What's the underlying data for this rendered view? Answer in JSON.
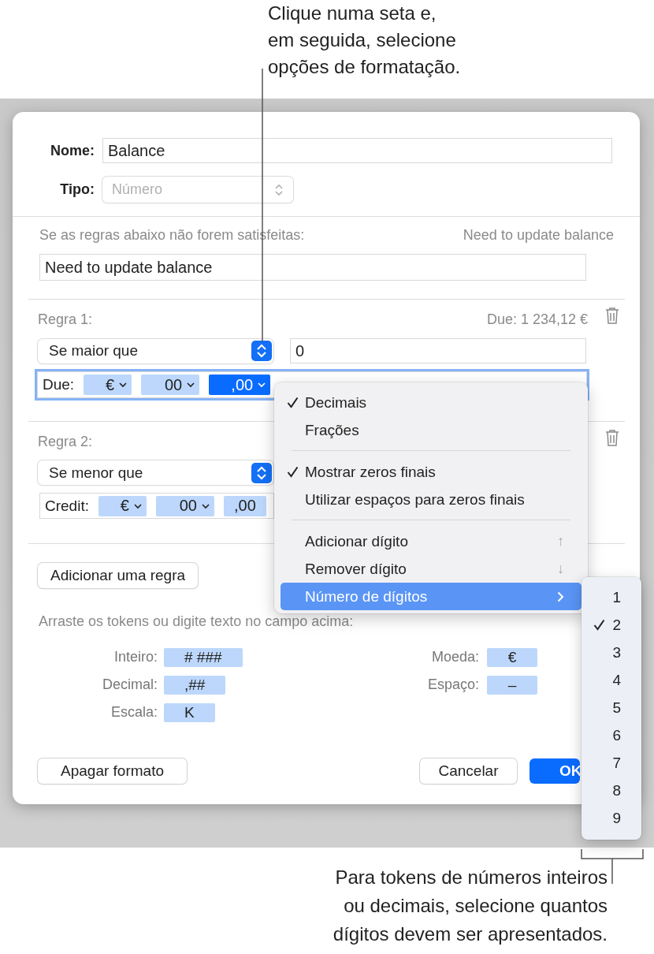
{
  "top_callout": "Clique numa seta e,\nem seguida, selecione\nopções de formatação.",
  "dialog": {
    "name_label": "Nome:",
    "name_value": "Balance",
    "type_label": "Tipo:",
    "type_value": "Número",
    "type_disabled": true,
    "fallback_label": "Se as regras abaixo não forem satisfeitas:",
    "fallback_preview": "Need to update balance",
    "fallback_value": "Need to update balance",
    "rules": [
      {
        "label": "Regra 1:",
        "preview": "Due: 1 234,12 €",
        "condition": "Se maior que",
        "value": "0",
        "format_focused": true,
        "format_label": "Due:",
        "tokens": [
          {
            "text": "€",
            "selected": false,
            "caret": true
          },
          {
            "text": "00",
            "selected": false,
            "caret": true
          },
          {
            "text": ",00",
            "selected": true,
            "caret": true
          }
        ]
      },
      {
        "label": "Regra 2:",
        "condition": "Se menor que",
        "format_focused": false,
        "format_label": "Credit:",
        "tokens": [
          {
            "text": "€",
            "selected": false,
            "caret": true
          },
          {
            "text": "00",
            "selected": false,
            "caret": true
          },
          {
            "text": ",00",
            "selected": false,
            "caret": false
          }
        ]
      }
    ],
    "add_rule_button": "Adicionar uma regra",
    "hint": "Arraste os tokens ou digite texto no campo acima:",
    "palette_left": [
      {
        "label": "Inteiro:",
        "token": "# ###"
      },
      {
        "label": "Decimal:",
        "token": ",##"
      },
      {
        "label": "Escala:",
        "token": "K"
      }
    ],
    "palette_right": [
      {
        "label": "Moeda:",
        "token": "€"
      },
      {
        "label": "Espaço:",
        "token": "–"
      }
    ],
    "buttons": [
      {
        "label": "Apagar formato",
        "kind": "plain"
      },
      {
        "label": "Cancelar",
        "kind": "plain"
      },
      {
        "label": "OK",
        "kind": "default"
      }
    ]
  },
  "menu": {
    "items": [
      {
        "kind": "item",
        "label": "Decimais",
        "checked": true
      },
      {
        "kind": "item",
        "label": "Frações",
        "checked": false
      },
      {
        "kind": "separator"
      },
      {
        "kind": "item",
        "label": "Mostrar zeros finais",
        "checked": true
      },
      {
        "kind": "item",
        "label": "Utilizar espaços para zeros finais",
        "checked": false
      },
      {
        "kind": "separator"
      },
      {
        "kind": "item",
        "label": "Adicionar dígito",
        "checked": false,
        "shortcut": "↑"
      },
      {
        "kind": "item",
        "label": "Remover dígito",
        "checked": false,
        "shortcut": "↓"
      },
      {
        "kind": "submenu",
        "label": "Número de dígitos",
        "selected": true
      }
    ]
  },
  "submenu": {
    "items": [
      {
        "label": "1",
        "checked": false
      },
      {
        "label": "2",
        "checked": true
      },
      {
        "label": "3",
        "checked": false
      },
      {
        "label": "4",
        "checked": false
      },
      {
        "label": "5",
        "checked": false
      },
      {
        "label": "6",
        "checked": false
      },
      {
        "label": "7",
        "checked": false
      },
      {
        "label": "8",
        "checked": false
      },
      {
        "label": "9",
        "checked": false
      }
    ]
  },
  "bottom_callout": "Para tokens de números inteiros\nou decimais, selecione quantos\ndígitos devem ser apresentados."
}
